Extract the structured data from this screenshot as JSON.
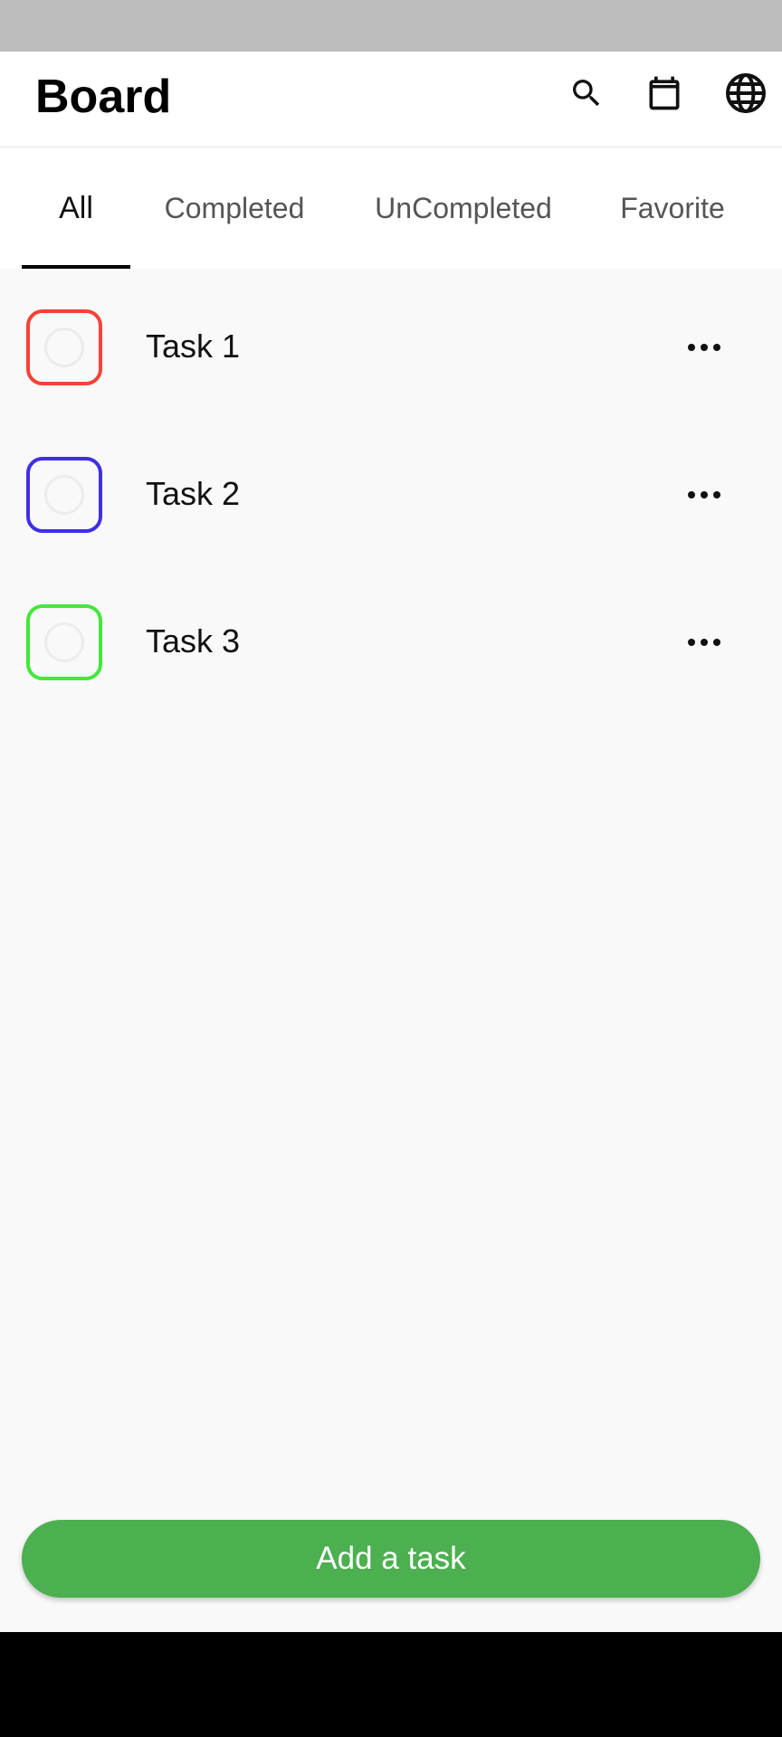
{
  "app_bar": {
    "title": "Board",
    "icons": [
      "search-icon",
      "calendar-icon",
      "globe-icon"
    ]
  },
  "tabs": [
    {
      "label": "All",
      "active": true
    },
    {
      "label": "Completed",
      "active": false
    },
    {
      "label": "UnCompleted",
      "active": false
    },
    {
      "label": "Favorite",
      "active": false
    }
  ],
  "tasks": [
    {
      "title": "Task 1",
      "color": "#f44336",
      "completed": false
    },
    {
      "title": "Task 2",
      "color": "#3f2ee6",
      "completed": false
    },
    {
      "title": "Task 3",
      "color": "#42e83a",
      "completed": false
    }
  ],
  "add_button": {
    "label": "Add a task",
    "color": "#4caf50"
  }
}
